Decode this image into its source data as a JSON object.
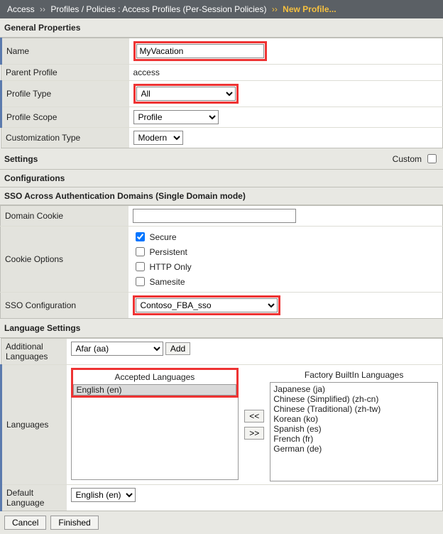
{
  "breadcrumb": {
    "root": "Access",
    "path1": "Profiles / Policies : Access Profiles (Per-Session Policies)",
    "leaf": "New Profile..."
  },
  "general": {
    "header": "General Properties",
    "name_label": "Name",
    "name_value": "MyVacation",
    "parent_label": "Parent Profile",
    "parent_value": "access",
    "type_label": "Profile Type",
    "type_value": "All",
    "scope_label": "Profile Scope",
    "scope_value": "Profile",
    "custom_label": "Customization Type",
    "custom_value": "Modern"
  },
  "settings": {
    "header": "Settings",
    "custom_label": "Custom"
  },
  "config": {
    "header": "Configurations",
    "sso_header": "SSO Across Authentication Domains (Single Domain mode)",
    "domain_cookie_label": "Domain Cookie",
    "domain_cookie_value": "",
    "cookie_options_label": "Cookie Options",
    "opt_secure": "Secure",
    "opt_persistent": "Persistent",
    "opt_httponly": "HTTP Only",
    "opt_samesite": "Samesite",
    "sso_config_label": "SSO Configuration",
    "sso_config_value": "Contoso_FBA_sso"
  },
  "lang": {
    "header": "Language Settings",
    "additional_label": "Additional Languages",
    "additional_value": "Afar (aa)",
    "add_btn": "Add",
    "languages_label": "Languages",
    "accepted_title": "Accepted Languages",
    "factory_title": "Factory BuiltIn Languages",
    "accepted_items": [
      "English (en)"
    ],
    "factory_items": [
      "Japanese (ja)",
      "Chinese (Simplified) (zh-cn)",
      "Chinese (Traditional) (zh-tw)",
      "Korean (ko)",
      "Spanish (es)",
      "French (fr)",
      "German (de)"
    ],
    "btn_left": "<<",
    "btn_right": ">>",
    "default_label": "Default Language",
    "default_value": "English (en)"
  },
  "footer": {
    "cancel": "Cancel",
    "finished": "Finished"
  }
}
